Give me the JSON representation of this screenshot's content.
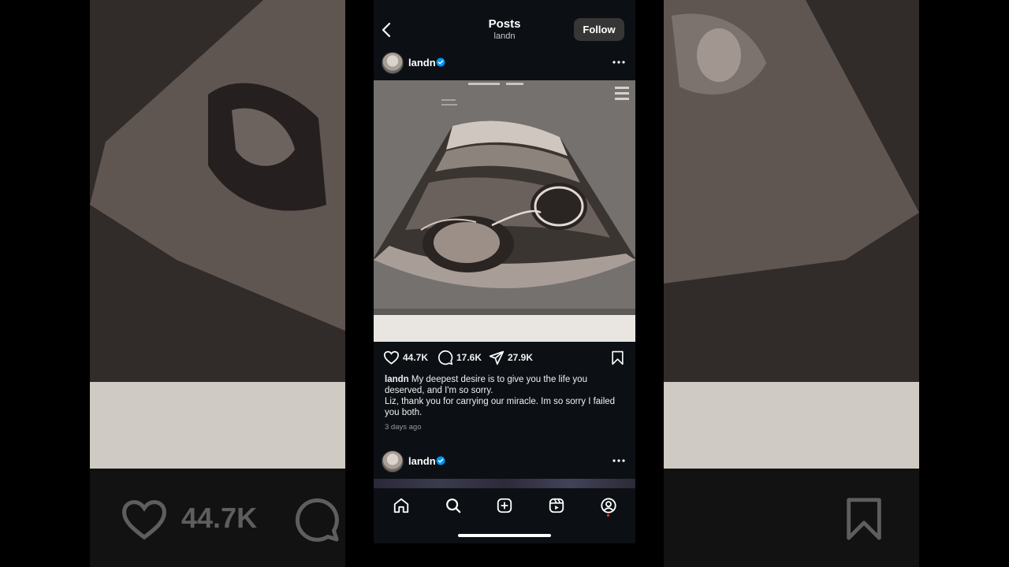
{
  "header": {
    "title": "Posts",
    "subtitle": "landn",
    "follow_label": "Follow"
  },
  "post": {
    "username": "landn",
    "verified": true,
    "likes": "44.7K",
    "comments": "17.6K",
    "shares": "27.9K",
    "caption_line1": "My deepest desire is to give you the life you deserved, and I'm so sorry.",
    "caption_line2": "Liz, thank you for carrying our miracle. Im so sorry I failed you both.",
    "timestamp": "3 days ago"
  },
  "next_post": {
    "username": "landn",
    "verified": true
  },
  "background": {
    "likes": "44.7K"
  },
  "tabs": [
    "home-icon",
    "search-icon",
    "create-icon",
    "reels-icon",
    "profile-icon"
  ],
  "colors": {
    "screen_bg": "#0c1014",
    "follow_bg": "#363636",
    "verified_blue": "#0095f6",
    "notification_red": "#ff3040"
  }
}
